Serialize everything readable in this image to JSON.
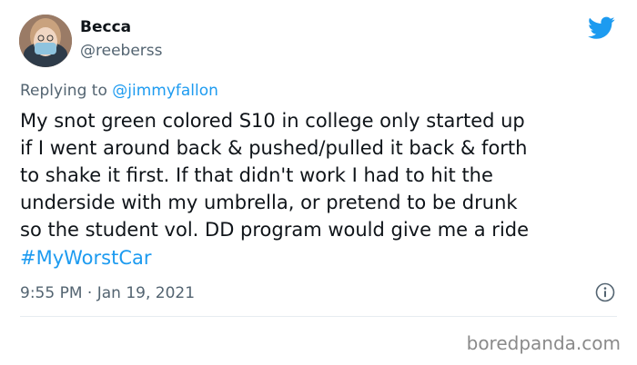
{
  "tweet": {
    "author_name": "Becca",
    "author_handle": "@reeberss",
    "replying_to_prefix": "Replying to",
    "replying_to_handle": "@jimmyfallon",
    "text": "My snot green colored S10 in college only started up\nif I went around back & pushed/pulled it back & forth\nto shake it first. If that didn't work I had to hit the\nunderside with my umbrella, or pretend to be drunk\nso the student vol. DD program would give me a ride",
    "hashtag": "#MyWorstCar",
    "timestamp": "9:55 PM · Jan 19, 2021"
  },
  "watermark": "boredpanda.com",
  "colors": {
    "accent": "#1d9bf0",
    "secondary_text": "#536471",
    "divider": "#e6ecf0"
  },
  "icons": {
    "brand": "twitter-bird-icon",
    "info": "info-icon"
  }
}
